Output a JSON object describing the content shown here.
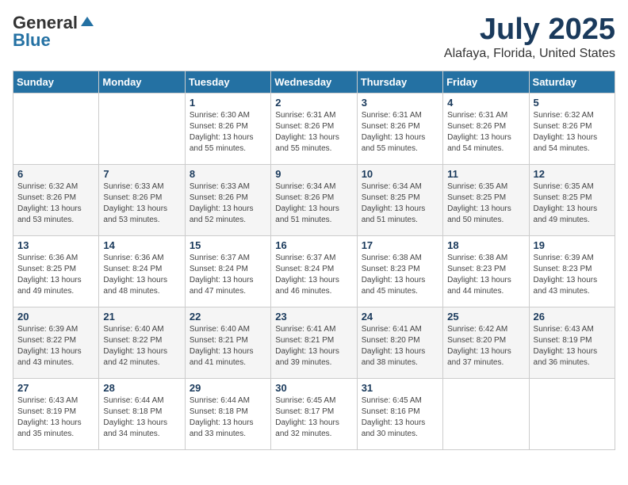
{
  "header": {
    "logo_general": "General",
    "logo_blue": "Blue",
    "month": "July 2025",
    "location": "Alafaya, Florida, United States"
  },
  "weekdays": [
    "Sunday",
    "Monday",
    "Tuesday",
    "Wednesday",
    "Thursday",
    "Friday",
    "Saturday"
  ],
  "weeks": [
    [
      {
        "day": "",
        "sunrise": "",
        "sunset": "",
        "daylight": ""
      },
      {
        "day": "",
        "sunrise": "",
        "sunset": "",
        "daylight": ""
      },
      {
        "day": "1",
        "sunrise": "Sunrise: 6:30 AM",
        "sunset": "Sunset: 8:26 PM",
        "daylight": "Daylight: 13 hours and 55 minutes."
      },
      {
        "day": "2",
        "sunrise": "Sunrise: 6:31 AM",
        "sunset": "Sunset: 8:26 PM",
        "daylight": "Daylight: 13 hours and 55 minutes."
      },
      {
        "day": "3",
        "sunrise": "Sunrise: 6:31 AM",
        "sunset": "Sunset: 8:26 PM",
        "daylight": "Daylight: 13 hours and 55 minutes."
      },
      {
        "day": "4",
        "sunrise": "Sunrise: 6:31 AM",
        "sunset": "Sunset: 8:26 PM",
        "daylight": "Daylight: 13 hours and 54 minutes."
      },
      {
        "day": "5",
        "sunrise": "Sunrise: 6:32 AM",
        "sunset": "Sunset: 8:26 PM",
        "daylight": "Daylight: 13 hours and 54 minutes."
      }
    ],
    [
      {
        "day": "6",
        "sunrise": "Sunrise: 6:32 AM",
        "sunset": "Sunset: 8:26 PM",
        "daylight": "Daylight: 13 hours and 53 minutes."
      },
      {
        "day": "7",
        "sunrise": "Sunrise: 6:33 AM",
        "sunset": "Sunset: 8:26 PM",
        "daylight": "Daylight: 13 hours and 53 minutes."
      },
      {
        "day": "8",
        "sunrise": "Sunrise: 6:33 AM",
        "sunset": "Sunset: 8:26 PM",
        "daylight": "Daylight: 13 hours and 52 minutes."
      },
      {
        "day": "9",
        "sunrise": "Sunrise: 6:34 AM",
        "sunset": "Sunset: 8:26 PM",
        "daylight": "Daylight: 13 hours and 51 minutes."
      },
      {
        "day": "10",
        "sunrise": "Sunrise: 6:34 AM",
        "sunset": "Sunset: 8:25 PM",
        "daylight": "Daylight: 13 hours and 51 minutes."
      },
      {
        "day": "11",
        "sunrise": "Sunrise: 6:35 AM",
        "sunset": "Sunset: 8:25 PM",
        "daylight": "Daylight: 13 hours and 50 minutes."
      },
      {
        "day": "12",
        "sunrise": "Sunrise: 6:35 AM",
        "sunset": "Sunset: 8:25 PM",
        "daylight": "Daylight: 13 hours and 49 minutes."
      }
    ],
    [
      {
        "day": "13",
        "sunrise": "Sunrise: 6:36 AM",
        "sunset": "Sunset: 8:25 PM",
        "daylight": "Daylight: 13 hours and 49 minutes."
      },
      {
        "day": "14",
        "sunrise": "Sunrise: 6:36 AM",
        "sunset": "Sunset: 8:24 PM",
        "daylight": "Daylight: 13 hours and 48 minutes."
      },
      {
        "day": "15",
        "sunrise": "Sunrise: 6:37 AM",
        "sunset": "Sunset: 8:24 PM",
        "daylight": "Daylight: 13 hours and 47 minutes."
      },
      {
        "day": "16",
        "sunrise": "Sunrise: 6:37 AM",
        "sunset": "Sunset: 8:24 PM",
        "daylight": "Daylight: 13 hours and 46 minutes."
      },
      {
        "day": "17",
        "sunrise": "Sunrise: 6:38 AM",
        "sunset": "Sunset: 8:23 PM",
        "daylight": "Daylight: 13 hours and 45 minutes."
      },
      {
        "day": "18",
        "sunrise": "Sunrise: 6:38 AM",
        "sunset": "Sunset: 8:23 PM",
        "daylight": "Daylight: 13 hours and 44 minutes."
      },
      {
        "day": "19",
        "sunrise": "Sunrise: 6:39 AM",
        "sunset": "Sunset: 8:23 PM",
        "daylight": "Daylight: 13 hours and 43 minutes."
      }
    ],
    [
      {
        "day": "20",
        "sunrise": "Sunrise: 6:39 AM",
        "sunset": "Sunset: 8:22 PM",
        "daylight": "Daylight: 13 hours and 43 minutes."
      },
      {
        "day": "21",
        "sunrise": "Sunrise: 6:40 AM",
        "sunset": "Sunset: 8:22 PM",
        "daylight": "Daylight: 13 hours and 42 minutes."
      },
      {
        "day": "22",
        "sunrise": "Sunrise: 6:40 AM",
        "sunset": "Sunset: 8:21 PM",
        "daylight": "Daylight: 13 hours and 41 minutes."
      },
      {
        "day": "23",
        "sunrise": "Sunrise: 6:41 AM",
        "sunset": "Sunset: 8:21 PM",
        "daylight": "Daylight: 13 hours and 39 minutes."
      },
      {
        "day": "24",
        "sunrise": "Sunrise: 6:41 AM",
        "sunset": "Sunset: 8:20 PM",
        "daylight": "Daylight: 13 hours and 38 minutes."
      },
      {
        "day": "25",
        "sunrise": "Sunrise: 6:42 AM",
        "sunset": "Sunset: 8:20 PM",
        "daylight": "Daylight: 13 hours and 37 minutes."
      },
      {
        "day": "26",
        "sunrise": "Sunrise: 6:43 AM",
        "sunset": "Sunset: 8:19 PM",
        "daylight": "Daylight: 13 hours and 36 minutes."
      }
    ],
    [
      {
        "day": "27",
        "sunrise": "Sunrise: 6:43 AM",
        "sunset": "Sunset: 8:19 PM",
        "daylight": "Daylight: 13 hours and 35 minutes."
      },
      {
        "day": "28",
        "sunrise": "Sunrise: 6:44 AM",
        "sunset": "Sunset: 8:18 PM",
        "daylight": "Daylight: 13 hours and 34 minutes."
      },
      {
        "day": "29",
        "sunrise": "Sunrise: 6:44 AM",
        "sunset": "Sunset: 8:18 PM",
        "daylight": "Daylight: 13 hours and 33 minutes."
      },
      {
        "day": "30",
        "sunrise": "Sunrise: 6:45 AM",
        "sunset": "Sunset: 8:17 PM",
        "daylight": "Daylight: 13 hours and 32 minutes."
      },
      {
        "day": "31",
        "sunrise": "Sunrise: 6:45 AM",
        "sunset": "Sunset: 8:16 PM",
        "daylight": "Daylight: 13 hours and 30 minutes."
      },
      {
        "day": "",
        "sunrise": "",
        "sunset": "",
        "daylight": ""
      },
      {
        "day": "",
        "sunrise": "",
        "sunset": "",
        "daylight": ""
      }
    ]
  ]
}
